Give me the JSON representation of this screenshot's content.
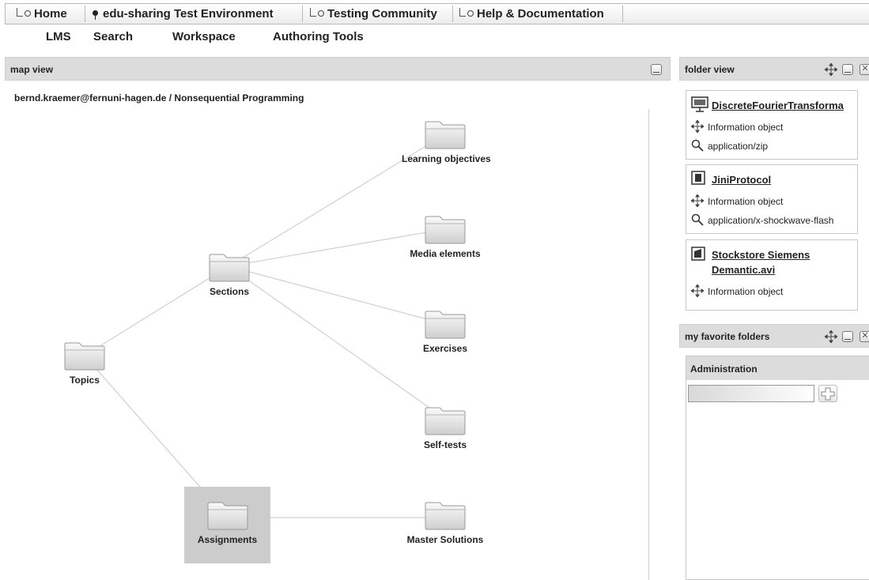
{
  "top_tabs": [
    {
      "label": "Home"
    },
    {
      "label": "edu-sharing Test Environment"
    },
    {
      "label": "Testing Community"
    },
    {
      "label": "Help & Documentation"
    }
  ],
  "main_menu": [
    {
      "label": "LMS"
    },
    {
      "label": "Search"
    },
    {
      "label": "Workspace"
    },
    {
      "label": "Authoring Tools"
    }
  ],
  "map_view": {
    "title": "map view",
    "breadcrumb": "bernd.kraemer@fernuni-hagen.de  /  Nonsequential Programming",
    "nodes": [
      {
        "label": "Learning objectives"
      },
      {
        "label": "Media elements"
      },
      {
        "label": "Sections"
      },
      {
        "label": "Exercises"
      },
      {
        "label": "Topics"
      },
      {
        "label": "Self-tests"
      },
      {
        "label": "Assignments",
        "selected": true
      },
      {
        "label": "Master Solutions"
      }
    ]
  },
  "folder_view": {
    "title": "folder view",
    "items": [
      {
        "title": "DiscreteFourierTransforma",
        "icon": "presentation-icon",
        "type": "Information object",
        "mime": "application/zip"
      },
      {
        "title": "JiniProtocol",
        "icon": "file-icon",
        "type": "Information object",
        "mime": "application/x-shockwave-flash"
      },
      {
        "title_line1": "Stockstore Siemens",
        "title_line2": "Demantic.avi",
        "icon": "video-icon",
        "type": "Information object"
      }
    ]
  },
  "favorites": {
    "title": "my favorite folders",
    "section": "Administration",
    "input_value": ""
  },
  "colors": {
    "panel_header": "#dcdcdc",
    "selection": "#cccccc",
    "edge": "#d0d0d0"
  }
}
